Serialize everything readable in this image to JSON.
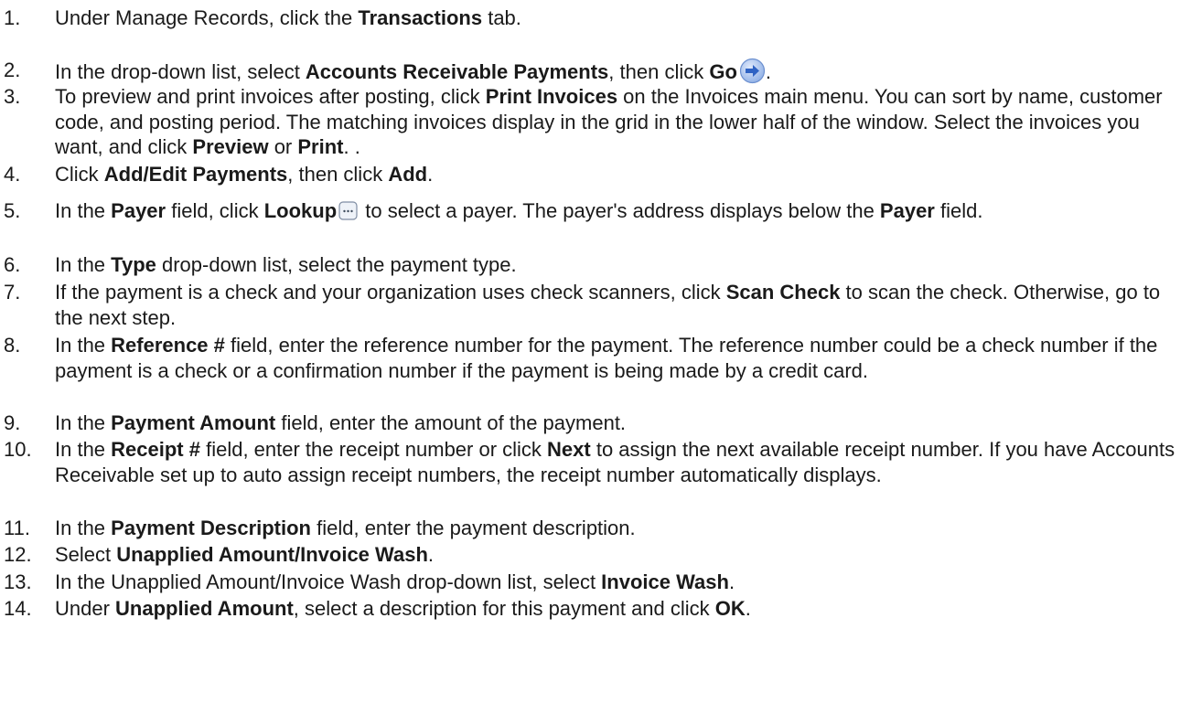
{
  "steps": [
    {
      "num": "1.",
      "parts": [
        {
          "t": "Under Manage Records, click the "
        },
        {
          "t": "Transactions",
          "b": true
        },
        {
          "t": " tab."
        }
      ]
    },
    {
      "num": "2.",
      "parts": [
        {
          "t": "In the drop-down list, select "
        },
        {
          "t": "Accounts Receivable Payments",
          "b": true
        },
        {
          "t": ", then click "
        },
        {
          "t": "Go",
          "b": true
        },
        {
          "icon": "go-arrow-icon"
        },
        {
          "t": "."
        }
      ]
    },
    {
      "num": "3.",
      "parts": [
        {
          "t": "To preview and print invoices after posting, click "
        },
        {
          "t": "Print Invoices",
          "b": true
        },
        {
          "t": " on the Invoices main menu. You can sort by name, customer code, and posting period. The matching invoices display in the grid in the lower half of the window. Select the invoices you want, and click "
        },
        {
          "t": "Preview",
          "b": true
        },
        {
          "t": " or "
        },
        {
          "t": "Print",
          "b": true
        },
        {
          "t": ". ."
        }
      ]
    },
    {
      "num": "4.",
      "parts": [
        {
          "t": "Click "
        },
        {
          "t": "Add/Edit Payments",
          "b": true
        },
        {
          "t": ", then click "
        },
        {
          "t": "Add",
          "b": true
        },
        {
          "t": "."
        }
      ]
    },
    {
      "num": "5.",
      "parts": [
        {
          "t": "In the "
        },
        {
          "t": "Payer",
          "b": true
        },
        {
          "t": " field, click "
        },
        {
          "t": "Lookup",
          "b": true
        },
        {
          "icon": "lookup-icon"
        },
        {
          "t": " to select a payer. The payer's address displays below the "
        },
        {
          "t": "Payer",
          "b": true
        },
        {
          "t": " field."
        }
      ]
    },
    {
      "num": "6.",
      "parts": [
        {
          "t": "In the "
        },
        {
          "t": "Type",
          "b": true
        },
        {
          "t": " drop-down list, select the payment type."
        }
      ]
    },
    {
      "num": "7.",
      "parts": [
        {
          "t": "If the payment is a check and your organization uses check scanners, click "
        },
        {
          "t": "Scan Check",
          "b": true
        },
        {
          "t": " to scan the check. Otherwise, go to the next step."
        }
      ]
    },
    {
      "num": "8.",
      "parts": [
        {
          "t": "In the "
        },
        {
          "t": "Reference #",
          "b": true
        },
        {
          "t": " field, enter the reference number for the payment. The reference number could be a check number if the payment is a check or a confirmation number if the payment is being made by a credit card."
        }
      ]
    },
    {
      "num": "9.",
      "parts": [
        {
          "t": "In the "
        },
        {
          "t": "Payment Amount",
          "b": true
        },
        {
          "t": " field, enter the amount of the payment."
        }
      ]
    },
    {
      "num": "10.",
      "parts": [
        {
          "t": "In the "
        },
        {
          "t": "Receipt #",
          "b": true
        },
        {
          "t": " field, enter the receipt number or click "
        },
        {
          "t": "Next",
          "b": true
        },
        {
          "t": " to assign the next available receipt number. If you have Accounts Receivable set up to auto assign receipt numbers, the receipt number automatically displays."
        }
      ]
    },
    {
      "num": "11.",
      "parts": [
        {
          "t": "In the "
        },
        {
          "t": "Payment Description",
          "b": true
        },
        {
          "t": " field, enter the payment description."
        }
      ]
    },
    {
      "num": "12.",
      "parts": [
        {
          "t": "Select "
        },
        {
          "t": "Unapplied Amount/Invoice Wash",
          "b": true
        },
        {
          "t": "."
        }
      ]
    },
    {
      "num": "13.",
      "parts": [
        {
          "t": "In the Unapplied Amount/Invoice Wash drop-down list, select "
        },
        {
          "t": "Invoice Wash",
          "b": true
        },
        {
          "t": "."
        }
      ]
    },
    {
      "num": "14.",
      "parts": [
        {
          "t": "Under "
        },
        {
          "t": "Unapplied Amount",
          "b": true
        },
        {
          "t": ", select a description for this payment and click "
        },
        {
          "t": "OK",
          "b": true
        },
        {
          "t": "."
        }
      ]
    }
  ],
  "colors": {
    "text": "#1a1a1a",
    "go_icon_blue": "#3b78d8"
  }
}
